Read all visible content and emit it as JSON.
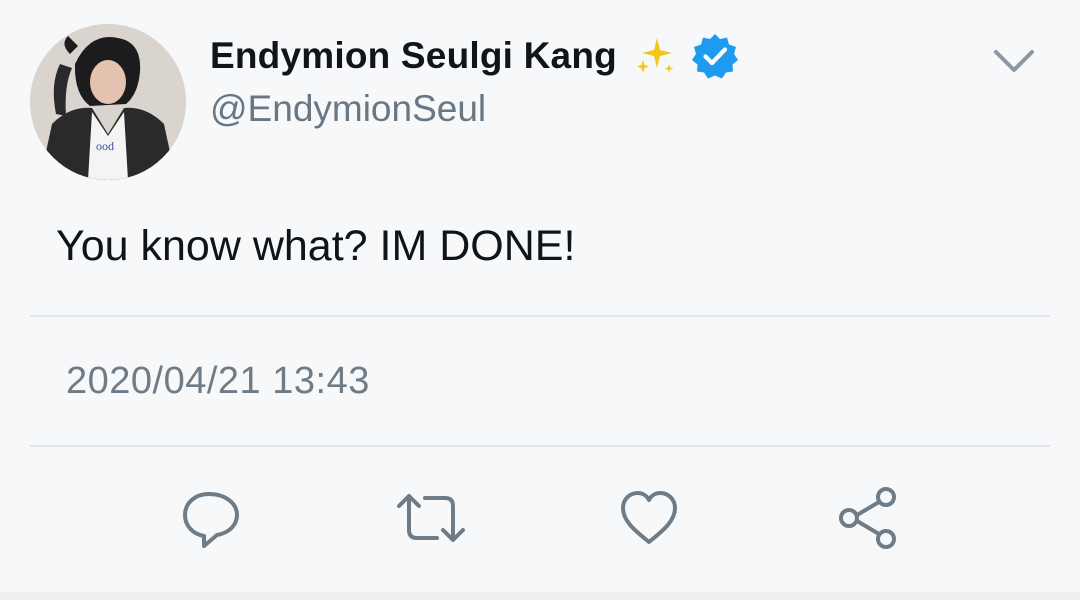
{
  "tweet": {
    "author": {
      "display_name": "Endymion Seulgi Kang",
      "handle": "@EndymionSeul",
      "avatar_icon": "profile-photo",
      "name_emoji": "sparkles-icon",
      "verified_icon": "verified-badge-icon"
    },
    "text": "You know what? IM DONE!",
    "timestamp": "2020/04/21 13:43",
    "menu_icon": "chevron-down-icon",
    "actions": [
      {
        "icon": "reply-icon"
      },
      {
        "icon": "retweet-icon"
      },
      {
        "icon": "like-icon"
      },
      {
        "icon": "share-icon"
      }
    ]
  },
  "colors": {
    "background": "#f7f8fa",
    "text_primary": "#0f1419",
    "text_secondary": "#687784",
    "verified_blue": "#1d9bf0",
    "sparkle_yellow": "#f5c518",
    "icon_gray": "#6e7c88",
    "divider": "#e3e6ea"
  }
}
